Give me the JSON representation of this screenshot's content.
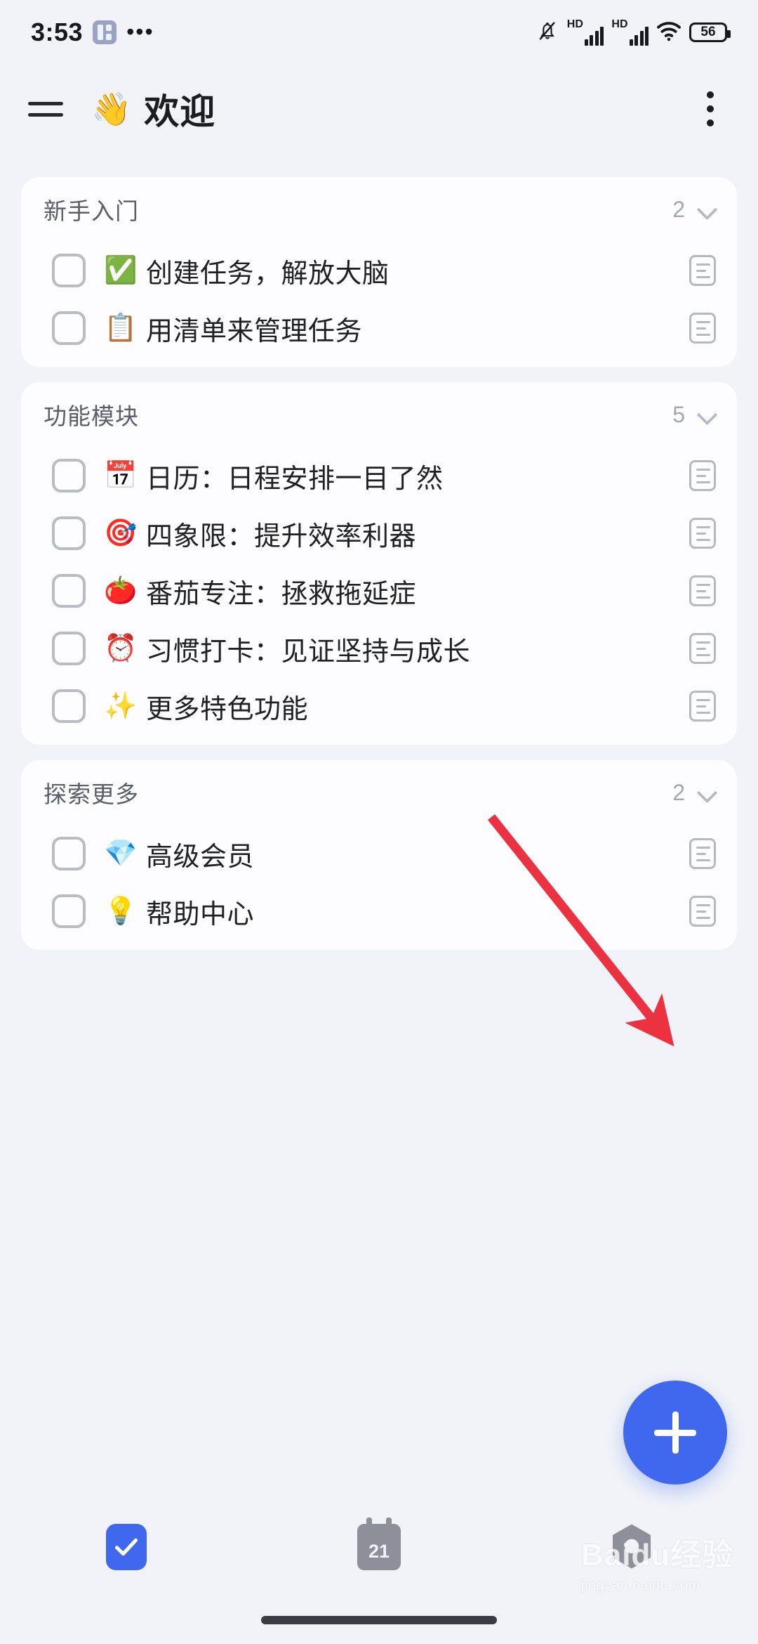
{
  "status_bar": {
    "time": "3:53",
    "app_icon": "grid-app-icon",
    "overflow": "•••",
    "mute_icon": "bell-muted-icon",
    "sim1_label": "HD",
    "sim2_label": "HD",
    "wifi_icon": "wifi-icon",
    "battery_level": "56"
  },
  "header": {
    "menu_icon": "hamburger-menu-icon",
    "emoji": "👋",
    "title": "欢迎",
    "overflow_icon": "more-vertical-icon"
  },
  "sections": [
    {
      "title": "新手入门",
      "count": "2",
      "tasks": [
        {
          "emoji": "✅",
          "text": "创建任务，解放大脑",
          "checked": false
        },
        {
          "emoji": "📋",
          "text": "用清单来管理任务",
          "checked": false
        }
      ]
    },
    {
      "title": "功能模块",
      "count": "5",
      "tasks": [
        {
          "emoji": "📅",
          "text": "日历：日程安排一目了然",
          "checked": false
        },
        {
          "emoji": "🎯",
          "text": "四象限：提升效率利器",
          "checked": false
        },
        {
          "emoji": "🍅",
          "text": "番茄专注：拯救拖延症",
          "checked": false
        },
        {
          "emoji": "⏰",
          "text": "习惯打卡：见证坚持与成长",
          "checked": false
        },
        {
          "emoji": "✨",
          "text": "更多特色功能",
          "checked": false
        }
      ]
    },
    {
      "title": "探索更多",
      "count": "2",
      "tasks": [
        {
          "emoji": "💎",
          "text": "高级会员",
          "checked": false
        },
        {
          "emoji": "💡",
          "text": "帮助中心",
          "checked": false
        }
      ]
    }
  ],
  "fab": {
    "icon": "plus-icon",
    "label": "+"
  },
  "bottom_nav": {
    "items": [
      {
        "name": "tasks",
        "icon": "check-icon",
        "active": true,
        "label": ""
      },
      {
        "name": "calendar",
        "icon": "calendar-icon",
        "active": false,
        "label": "21"
      },
      {
        "name": "focus",
        "icon": "hexagon-focus-icon",
        "active": false,
        "label": ""
      }
    ]
  },
  "annotation": {
    "type": "red-arrow",
    "color": "#ec3140"
  },
  "watermark": {
    "brand": "Baidu经验",
    "url": "jingyan.baidu.com"
  },
  "colors": {
    "accent": "#3f68ee",
    "background": "#f1f3f8",
    "card": "#fdfdff",
    "text": "#1e2026",
    "muted": "#a4a7b2",
    "annotation": "#ec3140"
  }
}
